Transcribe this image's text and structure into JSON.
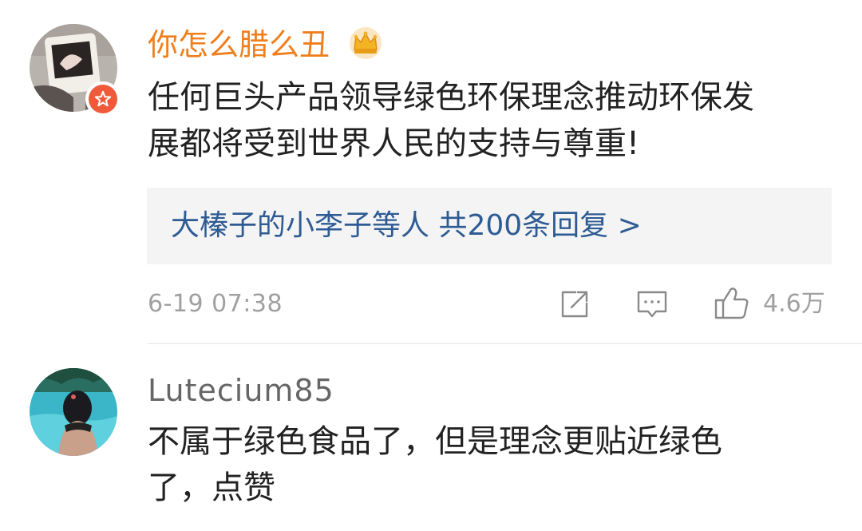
{
  "comments": [
    {
      "username": "你怎么腊么丑",
      "username_color": "#f07e1b",
      "avatar_icon": "avatar-photo",
      "badge_icon": "vip-star-icon",
      "name_badge_icon": "crown-icon",
      "text_lines": [
        "任何巨头产品领导绿色环保理念推动环保发",
        "展都将受到世界人民的支持与尊重!"
      ],
      "replies_summary": "大榛子的小李子等人  共200条回复 >",
      "time": "6-19 07:38",
      "likes": "4.6万"
    },
    {
      "username": "Lutecium85",
      "username_color": "#666666",
      "avatar_icon": "avatar-photo",
      "text_lines": [
        "不属于绿色食品了，但是理念更贴近绿色",
        "了，点赞"
      ]
    }
  ],
  "colors": {
    "reply_link": "#2e5b93",
    "meta_gray": "#a0a0a0",
    "body_text": "#222222"
  }
}
